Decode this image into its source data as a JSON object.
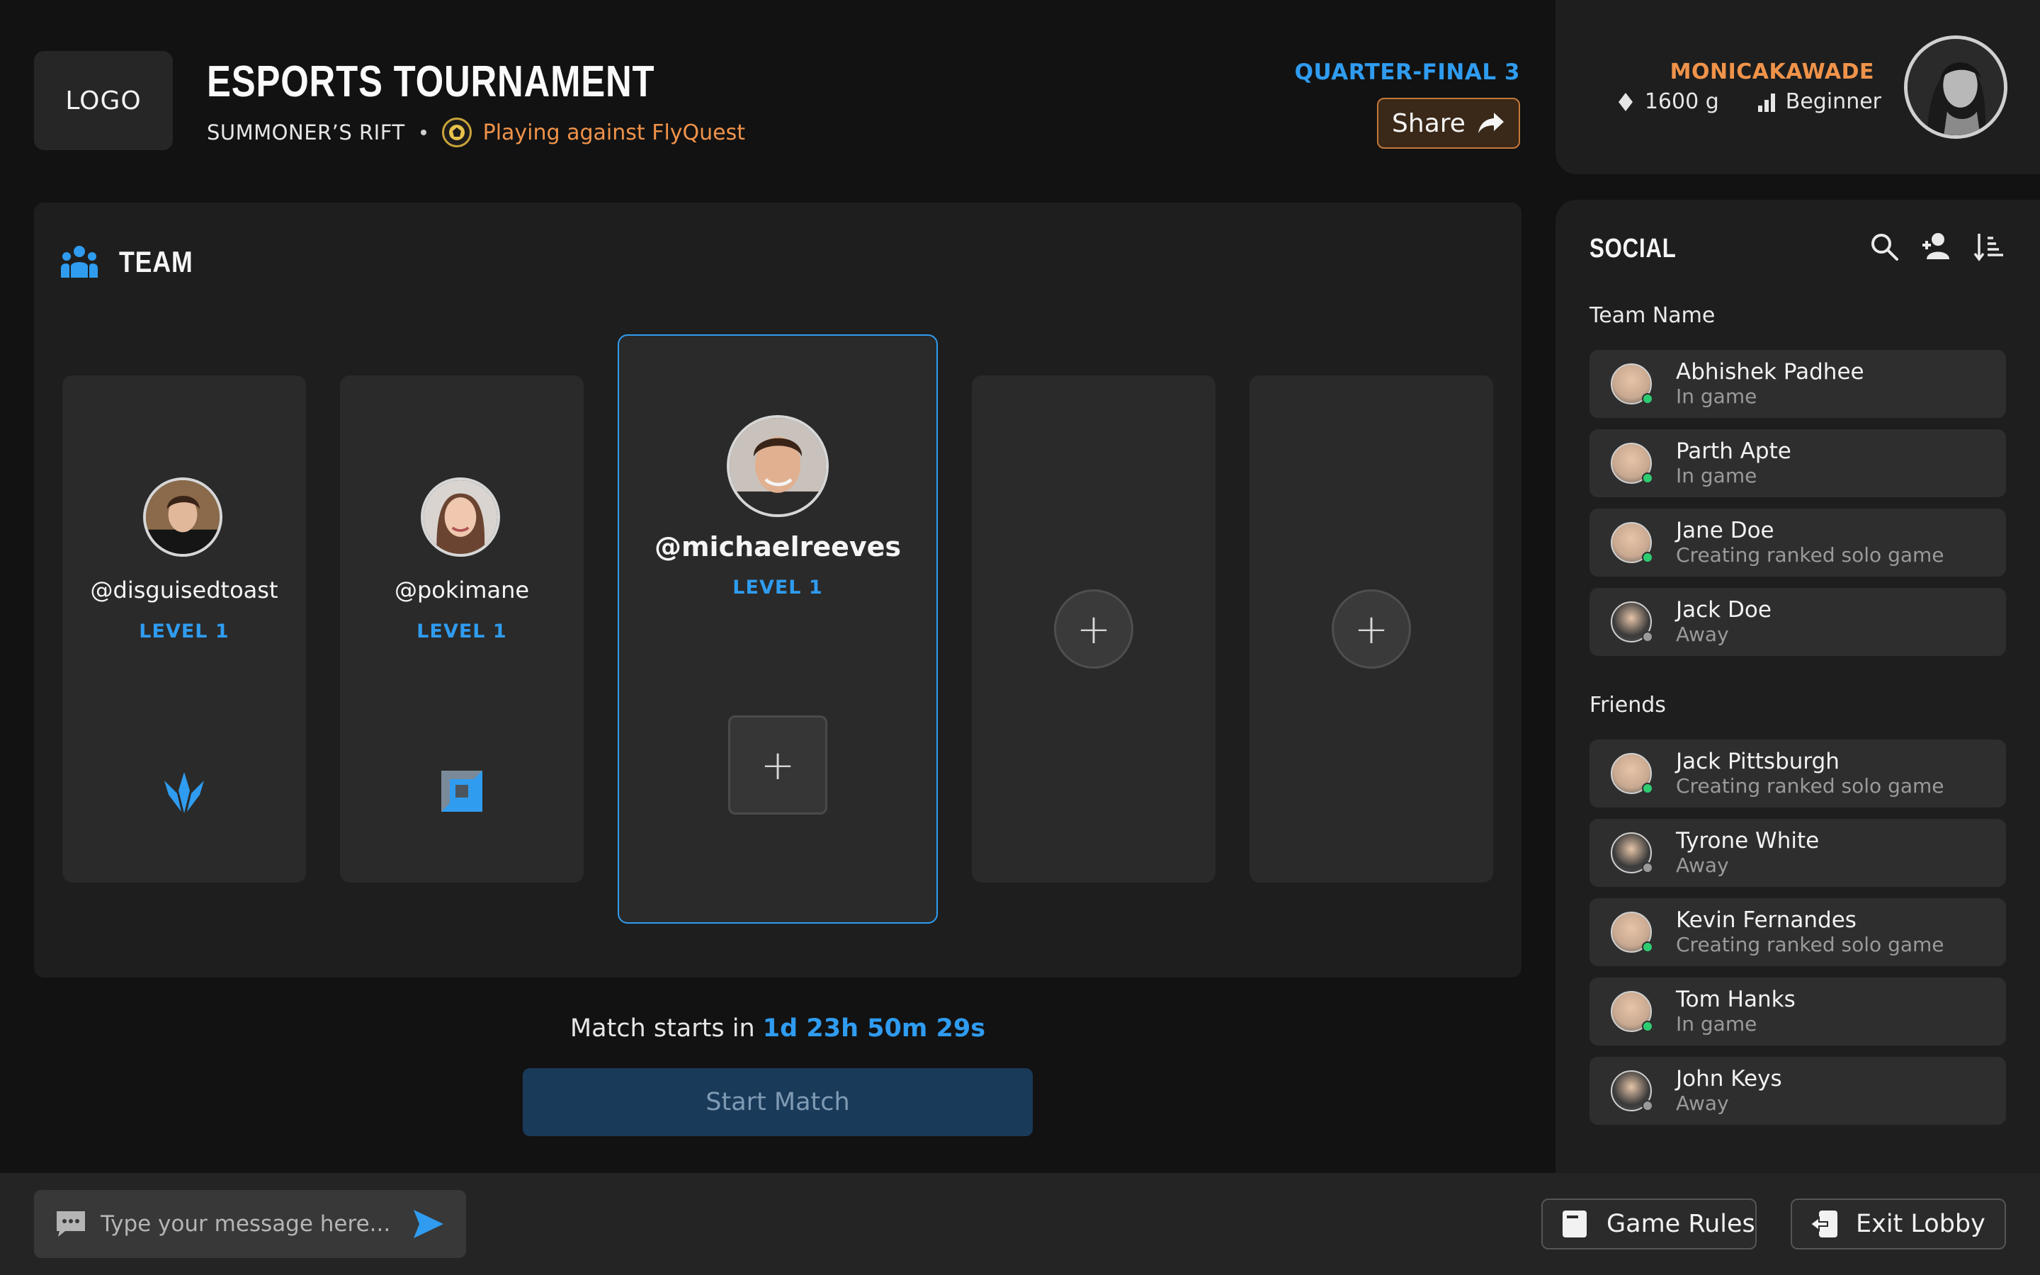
{
  "header": {
    "logo_text": "LOGO",
    "title": "ESPORTS TOURNAMENT",
    "map_name": "SUMMONER’S RIFT",
    "opponent_text": "Playing against FlyQuest",
    "round_label": "QUARTER-FINAL 3",
    "share_label": "Share"
  },
  "profile": {
    "username": "MONICAKAWADE",
    "gold": "1600 g",
    "rank": "Beginner"
  },
  "team": {
    "heading": "TEAM",
    "members": [
      {
        "handle": "@disguisedtoast",
        "level": "LEVEL 1"
      },
      {
        "handle": "@pokimane",
        "level": "LEVEL 1"
      },
      {
        "handle": "@michaelreeves",
        "level": "LEVEL 1"
      }
    ],
    "add_glyph": "+"
  },
  "match": {
    "countdown_prefix": "Match starts in ",
    "countdown_time": "1d 23h 50m 29s",
    "start_label": "Start Match"
  },
  "social": {
    "title": "SOCIAL",
    "team_section": "Team Name",
    "friends_section": "Friends",
    "team_members": [
      {
        "name": "Abhishek Padhee",
        "status": "In game",
        "online": true
      },
      {
        "name": "Parth Apte",
        "status": "In game",
        "online": true
      },
      {
        "name": "Jane Doe",
        "status": "Creating ranked solo game",
        "online": true
      },
      {
        "name": "Jack Doe",
        "status": "Away",
        "online": false
      }
    ],
    "friends": [
      {
        "name": "Jack Pittsburgh",
        "status": "Creating ranked solo game",
        "online": true
      },
      {
        "name": "Tyrone White",
        "status": "Away",
        "online": false
      },
      {
        "name": "Kevin Fernandes",
        "status": "Creating ranked solo game",
        "online": true
      },
      {
        "name": "Tom Hanks",
        "status": "In game",
        "online": true
      },
      {
        "name": "John Keys",
        "status": "Away",
        "online": false
      }
    ]
  },
  "chat": {
    "placeholder": "Type your message here..."
  },
  "footer": {
    "rules_label": "Game Rules",
    "exit_label": "Exit Lobby"
  },
  "colors": {
    "accent_blue": "#2f9cf0",
    "accent_orange": "#f0934a",
    "online": "#2ecc71",
    "away": "#9a9a9a"
  },
  "icons": {
    "team": "team-icon",
    "search": "search-icon",
    "add_user": "add-user-icon",
    "sort": "sort-icon",
    "chat": "chat-icon",
    "send": "send-icon",
    "rules": "rules-book-icon",
    "exit": "exit-icon",
    "share": "share-arrow-icon",
    "gold": "diamond-icon",
    "rank": "signal-bars-icon"
  }
}
